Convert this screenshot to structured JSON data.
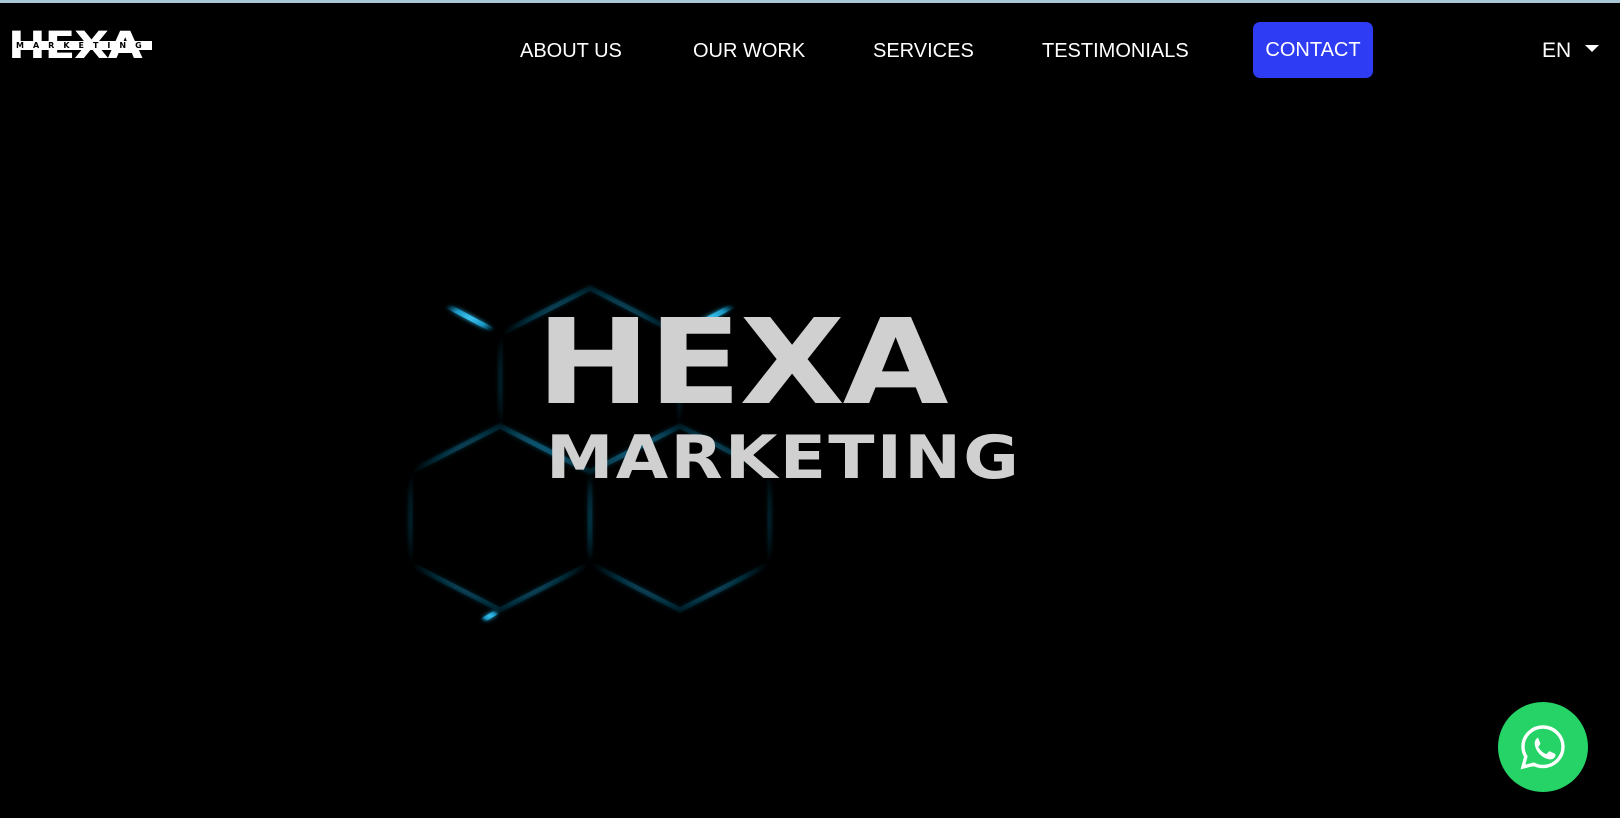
{
  "header": {
    "logo_text": "HEXA",
    "logo_subtext": "MARKETING",
    "nav": [
      {
        "label": "ABOUT US"
      },
      {
        "label": "OUR WORK"
      },
      {
        "label": "SERVICES"
      },
      {
        "label": "TESTIMONIALS"
      }
    ],
    "contact_label": "CONTACT",
    "language": "EN"
  },
  "hero": {
    "title": "HEXA",
    "subtitle": "MARKETING"
  },
  "colors": {
    "background": "#000000",
    "contact_button": "#2e3cf3",
    "hex_glow": "#1aa6d6",
    "whatsapp": "#25d366",
    "hero_text": "#d0d0d0"
  },
  "icons": {
    "whatsapp": "whatsapp-icon",
    "language_caret": "caret-down-icon",
    "background_pattern": "hexagon-pattern"
  }
}
